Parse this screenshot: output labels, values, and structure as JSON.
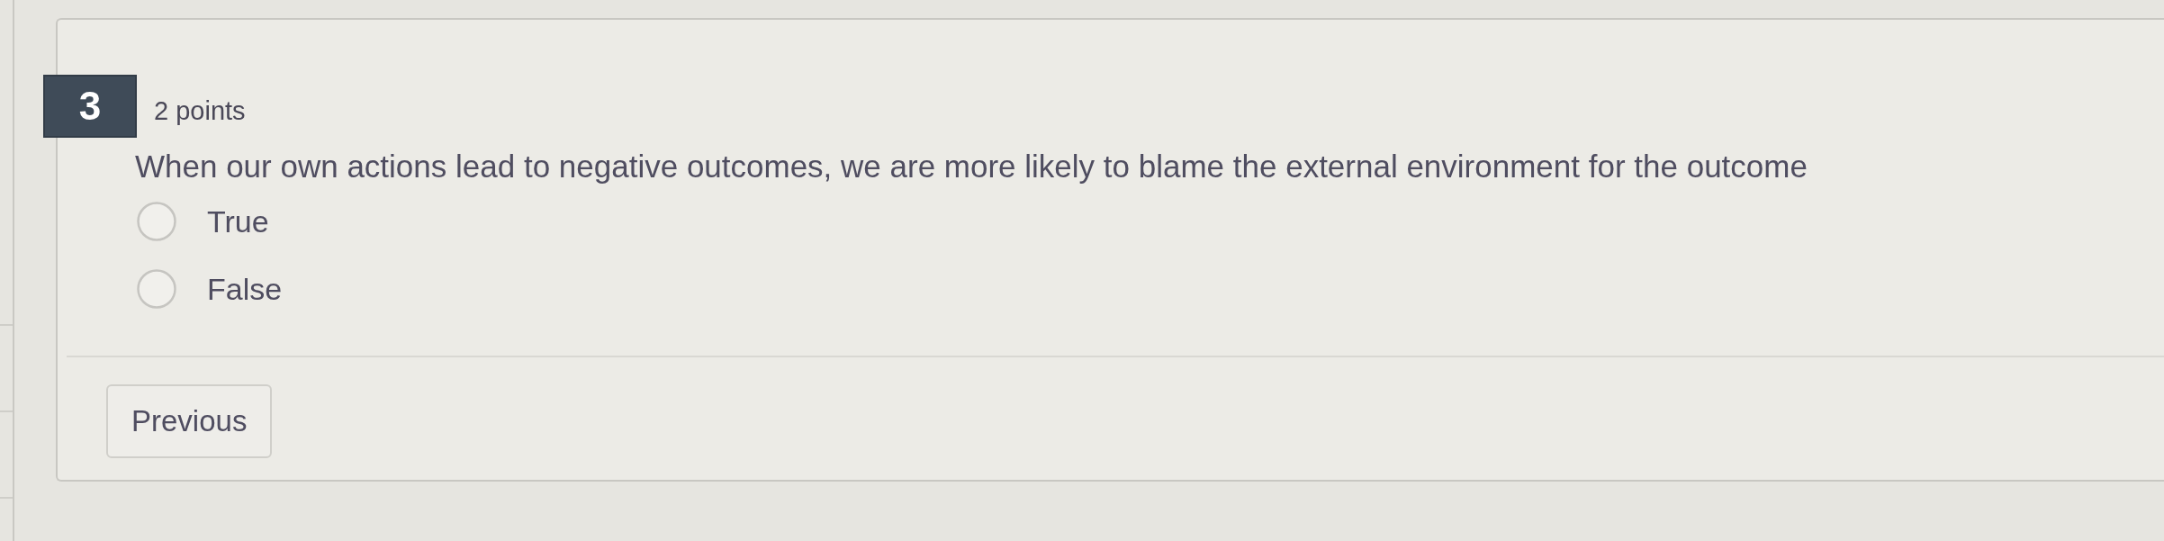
{
  "question": {
    "number": "3",
    "points": "2 points",
    "text": "When our own actions lead to negative outcomes, we are more likely to blame the external environment for the outcome",
    "options": [
      {
        "label": "True",
        "selected": false
      },
      {
        "label": "False",
        "selected": false
      }
    ]
  },
  "navigation": {
    "previous_button": "Previous"
  }
}
